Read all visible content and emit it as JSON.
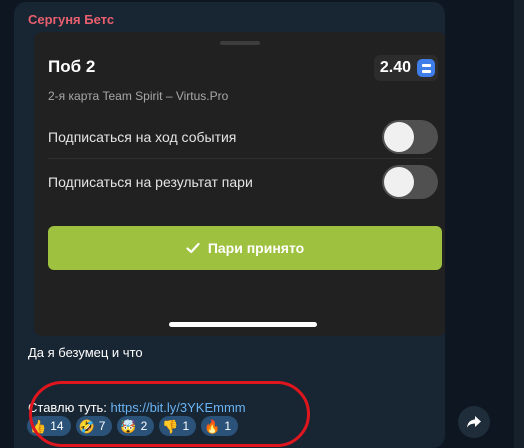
{
  "message": {
    "sender": "Сергуня Бетс",
    "caption": "Да я безумец и что",
    "link_prefix": "Ставлю туть: ",
    "link_url": "https://bit.ly/3YKEmmm"
  },
  "bet_card": {
    "market": "Поб 2",
    "odds": "2.40",
    "event": "2-я карта Team Spirit – Virtus.Pro",
    "toggles": [
      {
        "label": "Подписаться на ход события",
        "on": false
      },
      {
        "label": "Подписаться на результат пари",
        "on": false
      }
    ],
    "accept_label": "Пари принято",
    "accept_icon": "check-icon"
  },
  "reactions": [
    {
      "emoji": "👍",
      "count": "14"
    },
    {
      "emoji": "🤣",
      "count": "7"
    },
    {
      "emoji": "🤯",
      "count": "2"
    },
    {
      "emoji": "👎",
      "count": "1"
    },
    {
      "emoji": "🔥",
      "count": "1"
    }
  ],
  "colors": {
    "background": "#0e1621",
    "bubble": "#182533",
    "sender_name": "#e8606f",
    "card": "#212121",
    "accept_button": "#9fc140",
    "link": "#6ab3f3",
    "reaction_pill": "#2b5278",
    "annotation": "#e0161e"
  }
}
